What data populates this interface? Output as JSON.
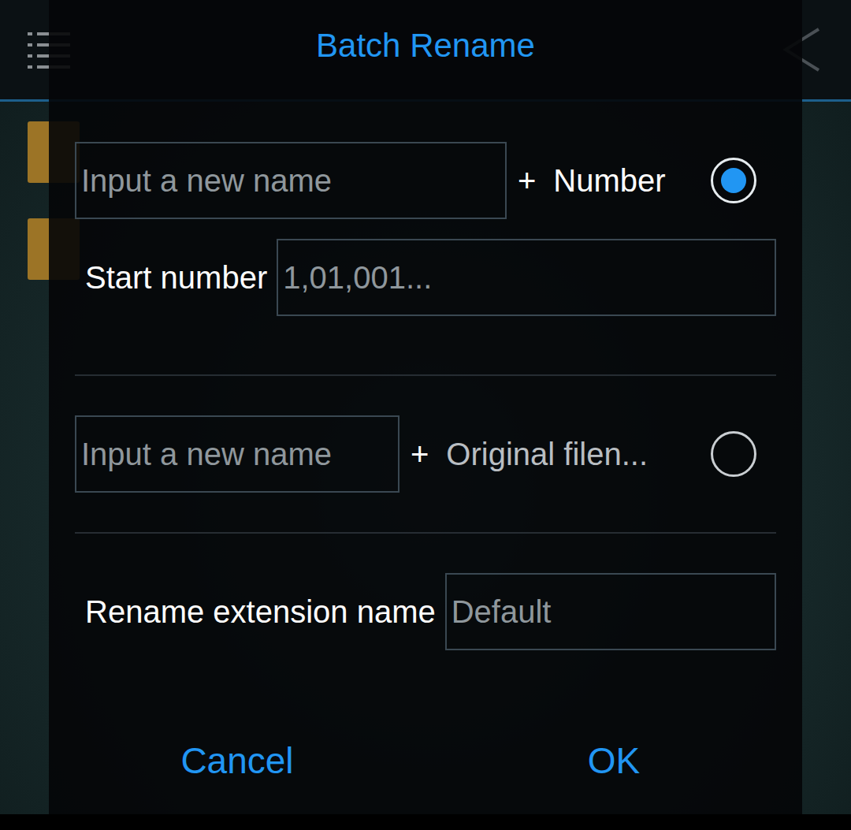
{
  "dialog": {
    "title": "Batch Rename"
  },
  "modes": [
    {
      "placeholder": "Input a new name",
      "plus": "+",
      "label": "Number",
      "selected": true,
      "start_number": {
        "label": "Start number",
        "placeholder": "1,01,001..."
      }
    },
    {
      "placeholder": "Input a new name",
      "plus": "+",
      "label": "Original filen...",
      "selected": false
    }
  ],
  "extension": {
    "label": "Rename extension name",
    "placeholder": "Default"
  },
  "buttons": [
    {
      "label": "Cancel"
    },
    {
      "label": "OK"
    }
  ]
}
